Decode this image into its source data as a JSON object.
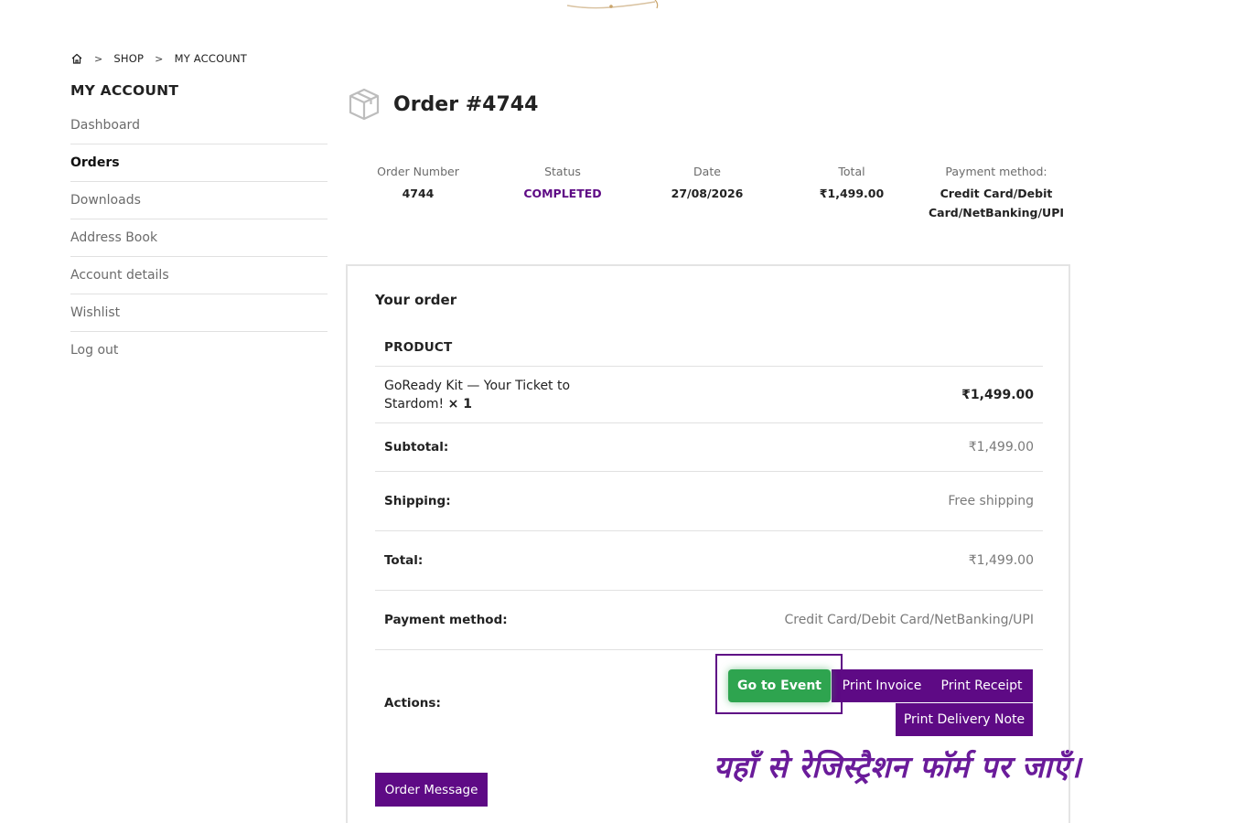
{
  "breadcrumb": {
    "items": [
      "SHOP",
      "MY ACCOUNT"
    ]
  },
  "sidebar": {
    "title": "MY ACCOUNT",
    "items": [
      {
        "label": "Dashboard"
      },
      {
        "label": "Orders"
      },
      {
        "label": "Downloads"
      },
      {
        "label": "Address Book"
      },
      {
        "label": "Account details"
      },
      {
        "label": "Wishlist"
      },
      {
        "label": "Log out"
      }
    ]
  },
  "order": {
    "title": "Order #4744",
    "overview": {
      "number_label": "Order Number",
      "number": "4744",
      "status_label": "Status",
      "status": "COMPLETED",
      "date_label": "Date",
      "date": "27/08/2026",
      "total_label": "Total",
      "total": "₹1,499.00",
      "payment_label": "Payment method:",
      "payment_line1": "Credit Card/Debit",
      "payment_line2": "Card/NetBanking/UPI"
    },
    "your_order": "Your order",
    "table": {
      "product_header": "PRODUCT",
      "product_line1": "GoReady Kit — Your Ticket to",
      "product_line2": "Stardom!",
      "quantity": "× 1",
      "product_price": "₹1,499.00",
      "subtotal_label": "Subtotal:",
      "subtotal": "₹1,499.00",
      "shipping_label": "Shipping:",
      "shipping": "Free shipping",
      "total_label": "Total:",
      "total": "₹1,499.00",
      "payment_label": "Payment method:",
      "payment": "Credit Card/Debit Card/NetBanking/UPI",
      "actions_label": "Actions:"
    },
    "actions": {
      "go_to_event": "Go to Event",
      "print_invoice": "Print Invoice",
      "print_receipt": "Print Receipt",
      "print_delivery_note": "Print Delivery Note"
    },
    "order_message": "Order Message"
  },
  "annotation": {
    "hindi_text": "यहाँ से रेजिस्ट्रैशन फॉर्म पर जाएँ।"
  },
  "colors": {
    "accent": "#5e0a85",
    "event_button": "#2ea44f"
  },
  "icons": {
    "home": "home-icon",
    "order": "box-icon"
  }
}
